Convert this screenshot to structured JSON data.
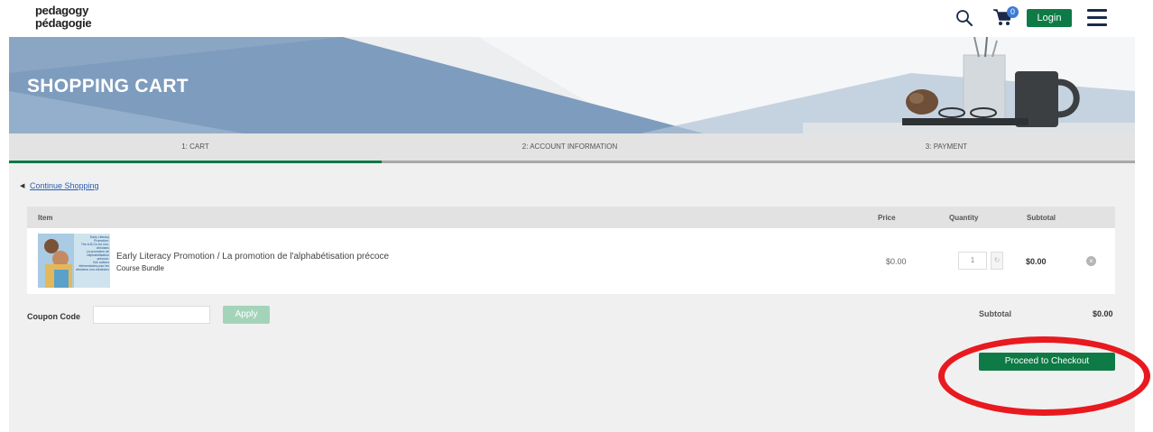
{
  "header": {
    "logo_line1": "pedagogy",
    "logo_line2": "pédagogie",
    "cart_count": "0",
    "login_label": "Login"
  },
  "banner": {
    "title": "SHOPPING CART"
  },
  "steps": [
    {
      "label": "1: CART",
      "active": true
    },
    {
      "label": "2: ACCOUNT INFORMATION",
      "active": false
    },
    {
      "label": "3: PAYMENT",
      "active": false
    }
  ],
  "cart": {
    "continue_label": "Continue Shopping",
    "columns": {
      "item": "Item",
      "price": "Price",
      "quantity": "Quantity",
      "subtotal": "Subtotal"
    },
    "items": [
      {
        "title": "Early Literacy Promotion / La promotion de l'alphabétisation précoce",
        "type": "Course Bundle",
        "price": "$0.00",
        "quantity": "1",
        "subtotal": "$0.00",
        "thumbnail_text": [
          "Early Literacy Promotion:",
          "The A-B-Cs for non-clinicians",
          "La promotion de l'alphabétisation précoce:",
          "Vos notions élémentaires pour les cliniciens non-médecins"
        ]
      }
    ],
    "coupon": {
      "label": "Coupon Code",
      "value": "",
      "apply_label": "Apply"
    },
    "summary": {
      "subtotal_label": "Subtotal",
      "subtotal_value": "$0.00"
    },
    "checkout_label": "Proceed to Checkout"
  },
  "colors": {
    "brand_green": "#0e7a45",
    "link_blue": "#2a5db0",
    "highlight_red": "#e8191f",
    "banner_blue": "#7e9cbd"
  }
}
